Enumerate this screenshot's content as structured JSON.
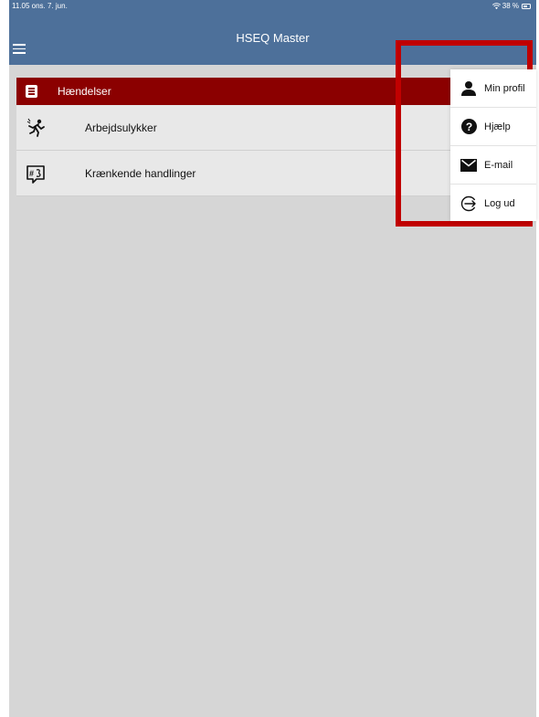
{
  "status_bar": {
    "time_date": "11.05  ons. 7. jun.",
    "battery": "38 %"
  },
  "header": {
    "title": "HSEQ Master"
  },
  "section": {
    "title": "Hændelser"
  },
  "list": [
    {
      "label": "Arbejdsulykker",
      "icon": "falling-person-icon"
    },
    {
      "label": "Krænkende handlinger",
      "icon": "hashtag-chat-icon"
    }
  ],
  "dropdown": {
    "items": [
      {
        "label": "Min profil",
        "icon": "person-icon"
      },
      {
        "label": "Hjælp",
        "icon": "help-icon"
      },
      {
        "label": "E-mail",
        "icon": "mail-icon"
      },
      {
        "label": "Log ud",
        "icon": "logout-icon"
      }
    ]
  },
  "colors": {
    "header": "#4d709a",
    "section": "#8b0000",
    "background": "#d6d6d6",
    "highlight": "#c00000"
  }
}
